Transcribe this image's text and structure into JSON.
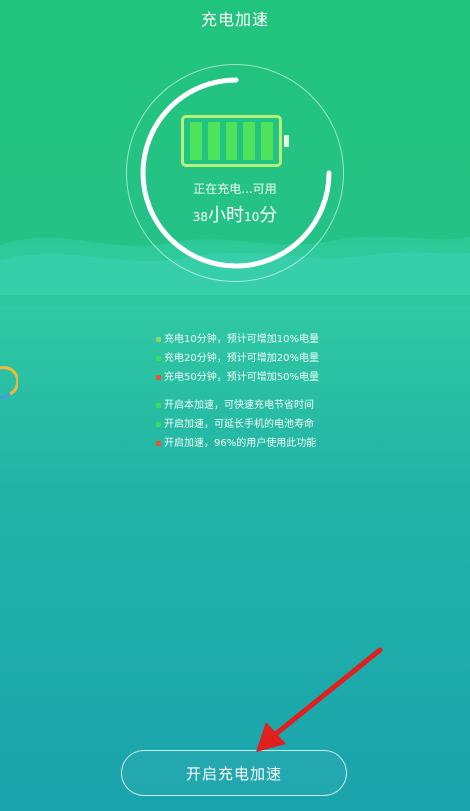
{
  "header": {
    "title": "充电加速"
  },
  "charge": {
    "status_text": "正在充电...可用",
    "hours": "38",
    "hours_unit": "小时",
    "minutes": "10",
    "minutes_unit": "分"
  },
  "battery": {
    "filled_cells": 5,
    "total_cells": 5,
    "fill_color": "#4ee35c",
    "frame_color": "#b7ef7c"
  },
  "tips_group1": [
    {
      "text": "充电10分钟，预计可增加10%电量",
      "color": "#8fd46a"
    },
    {
      "text": "充电20分钟，预计可增加20%电量",
      "color": "#3ddc5c"
    },
    {
      "text": "充电50分钟，预计可增加50%电量",
      "color": "#e8552f"
    }
  ],
  "tips_group2": [
    {
      "text": "开启本加速，可快速充电节省时间",
      "color": "#3ddc5c"
    },
    {
      "text": "开启加速，可延长手机的电池寿命",
      "color": "#3ddc5c"
    },
    {
      "text": "开启加速，96%的用户使用此功能",
      "color": "#e8552f"
    }
  ],
  "cta": {
    "label": "开启充电加速"
  },
  "colors": {
    "background_top": "#21c47c",
    "background_bottom": "#1aa4ad",
    "annotation_arrow": "#e21f1f"
  }
}
